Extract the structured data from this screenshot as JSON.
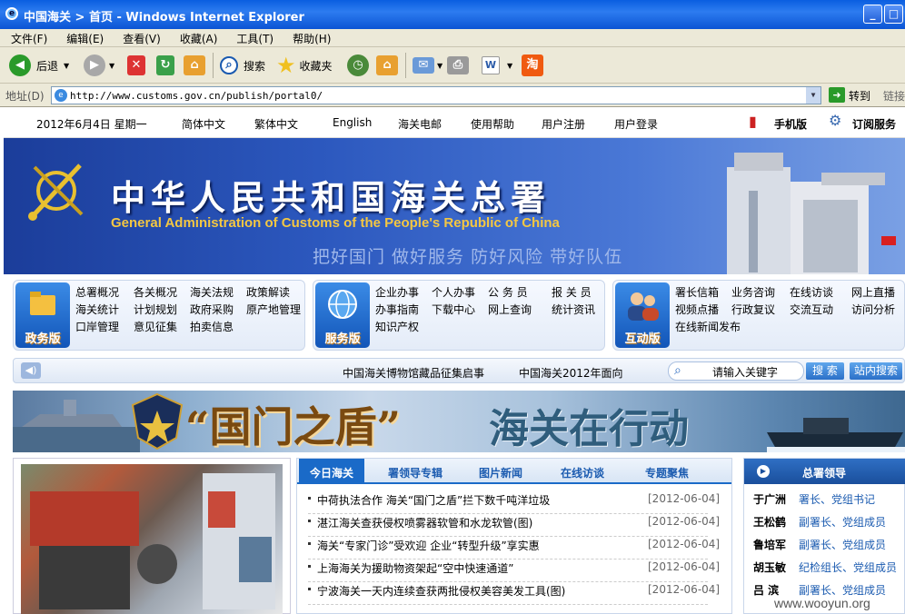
{
  "window": {
    "title": "中国海关 > 首页 - Windows Internet Explorer"
  },
  "menu": [
    "文件(F)",
    "编辑(E)",
    "查看(V)",
    "收藏(A)",
    "工具(T)",
    "帮助(H)"
  ],
  "toolbar": {
    "back": "后退",
    "search": "搜索",
    "favorites": "收藏夹"
  },
  "address": {
    "label": "地址(D)",
    "url": "http://www.customs.gov.cn/publish/portal0/",
    "go": "转到",
    "links": "链接"
  },
  "topnav": {
    "date": "2012年6月4日 星期一",
    "items": [
      "简体中文",
      "繁体中文",
      "English",
      "海关电邮",
      "使用帮助",
      "用户注册",
      "用户登录"
    ],
    "mobile": "手机版",
    "subscribe": "订阅服务"
  },
  "banner": {
    "title_cn": "中华人民共和国海关总署",
    "title_en": "General Administration of Customs of the People's Republic of China",
    "slogan": "把好国门 做好服务 防好风险 带好队伍"
  },
  "categories": [
    {
      "label": "政务版",
      "links": [
        "总署概况",
        "各关概况",
        "海关法规",
        "政策解读",
        "海关统计",
        "计划规划",
        "政府采购",
        "原产地管理",
        "口岸管理",
        "意见征集",
        "拍卖信息"
      ]
    },
    {
      "label": "服务版",
      "links": [
        "企业办事",
        "个人办事",
        "公 务 员",
        "报 关 员",
        "办事指南",
        "下载中心",
        "网上查询",
        "统计资讯",
        "知识产权"
      ]
    },
    {
      "label": "互动版",
      "links": [
        "署长信箱",
        "业务咨询",
        "在线访谈",
        "网上直播",
        "视频点播",
        "行政复议",
        "交流互动",
        "访问分析",
        "在线新闻发布"
      ]
    }
  ],
  "search": {
    "ticker1": "中国海关博物馆藏品征集启事",
    "ticker2": "中国海关2012年面向",
    "placeholder": "请输入关键字",
    "btn_search": "搜 索",
    "btn_site": "站内搜索"
  },
  "promo": {
    "text1": "“国门之盾”",
    "text2": "海关在行动"
  },
  "news": {
    "tabs": [
      "今日海关",
      "署领导专辑",
      "图片新闻",
      "在线访谈",
      "专题聚焦"
    ],
    "items": [
      {
        "title": "中荷执法合作 海关“国门之盾”拦下数千吨洋垃圾",
        "date": "[2012-06-04]"
      },
      {
        "title": "湛江海关查获侵权喷雾器软管和水龙软管(图)",
        "date": "[2012-06-04]"
      },
      {
        "title": "海关“专家门诊”受欢迎 企业“转型升级”享实惠",
        "date": "[2012-06-04]"
      },
      {
        "title": "上海海关为援助物资架起“空中快速通道”",
        "date": "[2012-06-04]"
      },
      {
        "title": "宁波海关一天内连续查获两批侵权美容美发工具(图)",
        "date": "[2012-06-04]"
      }
    ]
  },
  "leaders": {
    "title": "总署领导",
    "list": [
      {
        "name": "于广洲",
        "post": "署长、党组书记"
      },
      {
        "name": "王松鹤",
        "post": "副署长、党组成员"
      },
      {
        "name": "鲁培军",
        "post": "副署长、党组成员"
      },
      {
        "name": "胡玉敏",
        "post": "纪检组长、党组成员"
      },
      {
        "name": "吕 滨",
        "post": "副署长、党组成员"
      }
    ]
  },
  "watermark": "www.wooyun.org"
}
